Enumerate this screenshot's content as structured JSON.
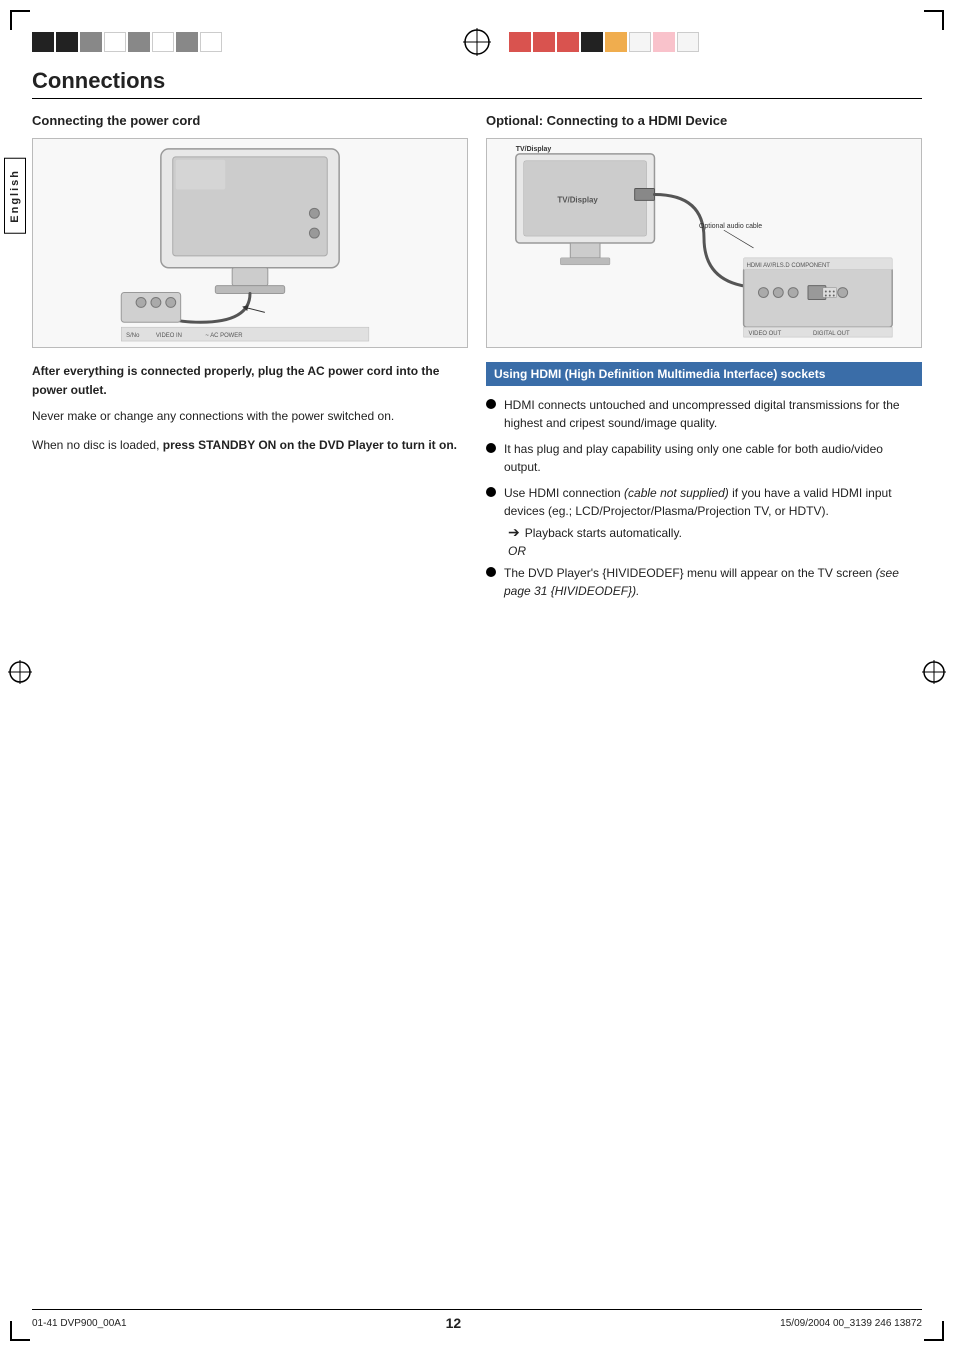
{
  "page": {
    "title": "Connections",
    "page_number": "12",
    "footer_left": "01-41 DVP900_00A1",
    "footer_center": "12",
    "footer_right": "15/09/2004  00_3139  246 13872",
    "language_tab": "English"
  },
  "left_section": {
    "heading": "Connecting the power cord",
    "para1_bold": "After everything is connected properly, plug the AC power cord into the power outlet.",
    "para1_normal": "Never make or change any connections with the power switched on.",
    "para2_prefix": "When no disc is loaded, ",
    "para2_bold": "press STANDBY ON on the DVD Player to turn it on."
  },
  "right_section": {
    "heading": "Optional: Connecting to a HDMI Device",
    "box_heading": "Using HDMI (High Definition Multimedia Interface) sockets",
    "bullets": [
      "HDMI connects untouched and uncompressed digital transmissions for the highest and cripest sound/image quality.",
      "It has plug and play capability using only one cable for both audio/video output.",
      "Use HDMI connection (cable not supplied) if you have a valid HDMI input devices (eg.; LCD/Projector/Plasma/Projection TV, or HDTV).",
      "The DVD Player's {HIVIDEODEF} menu will appear on the TV screen (see page 31 {HIVIDEODEF})."
    ],
    "bullet3_arrow": "Playback starts automatically.",
    "bullet3_or": "OR",
    "bullet3_italic_parts": [
      "(cable not supplied)",
      "(see page 31 {HIVIDEODEF})."
    ],
    "tv_display_label": "TV/Display",
    "optional_audio_label": "Optional audio cable"
  }
}
